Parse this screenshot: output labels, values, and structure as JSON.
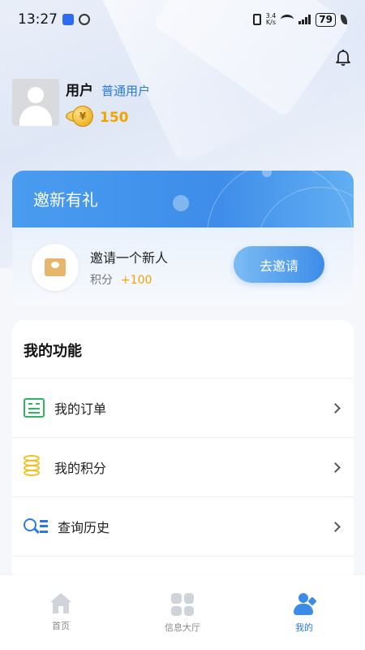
{
  "status_bar": {
    "time": "13:27",
    "net_speed_top": "3.4",
    "net_speed_bottom": "K/s",
    "battery": "79"
  },
  "profile": {
    "name": "用户",
    "level": "普通用户",
    "points": "150"
  },
  "invite": {
    "title": "邀新有礼",
    "main_text": "邀请一个新人",
    "points_label": "积分",
    "points_bonus": "+100",
    "button_label": "去邀请"
  },
  "functions": {
    "title": "我的功能",
    "items": [
      {
        "label": "我的订单",
        "icon": "order-icon"
      },
      {
        "label": "我的积分",
        "icon": "points-coins-icon"
      },
      {
        "label": "查询历史",
        "icon": "search-history-icon"
      }
    ]
  },
  "bottom_nav": {
    "items": [
      {
        "label": "首页",
        "icon": "home-icon",
        "active": false
      },
      {
        "label": "信息大厅",
        "icon": "grid-icon",
        "active": false
      },
      {
        "label": "我的",
        "icon": "profile-icon",
        "active": true
      }
    ]
  },
  "colors": {
    "accent": "#2a7ae2",
    "points_gold": "#f0a400",
    "order_green": "#2fb463"
  }
}
